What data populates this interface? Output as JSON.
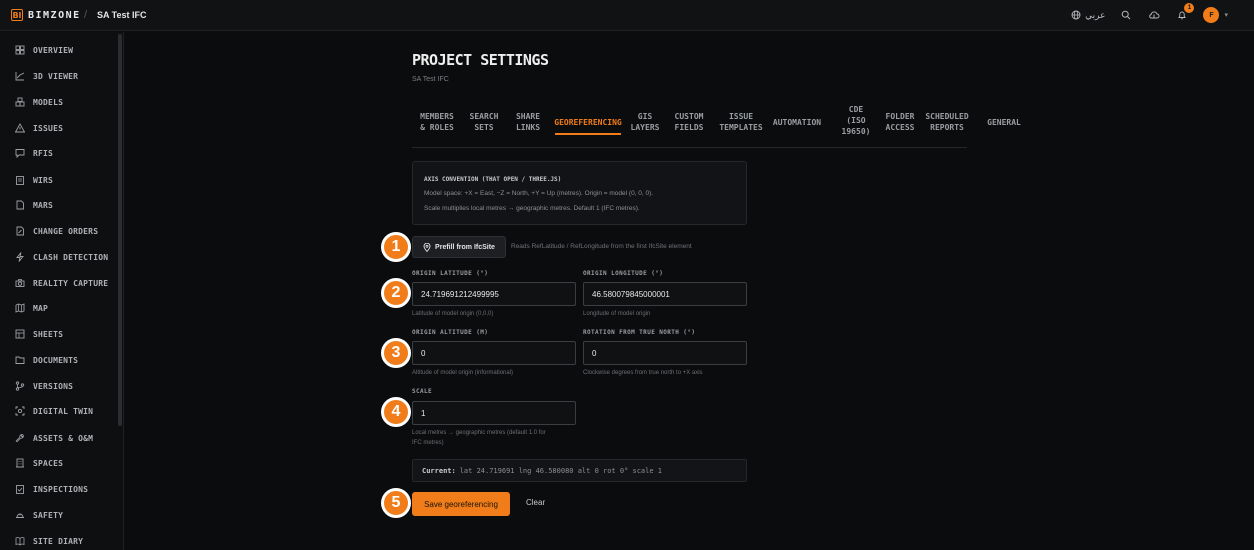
{
  "topbar": {
    "logo_mark": "BI",
    "logo_text": "BIMZONE",
    "crumb_sep": "/",
    "project": "SA Test IFC",
    "language": "عربي",
    "notif_count": "1",
    "avatar_initial": "F"
  },
  "sidebar": {
    "items": [
      {
        "label": "OVERVIEW",
        "icon": "grid-icon"
      },
      {
        "label": "3D VIEWER",
        "icon": "axes-icon"
      },
      {
        "label": "MODELS",
        "icon": "cubes-icon"
      },
      {
        "label": "ISSUES",
        "icon": "warning-icon"
      },
      {
        "label": "RFIS",
        "icon": "message-icon"
      },
      {
        "label": "WIRS",
        "icon": "clipboard-icon"
      },
      {
        "label": "MARS",
        "icon": "document-icon"
      },
      {
        "label": "CHANGE ORDERS",
        "icon": "edit-doc-icon"
      },
      {
        "label": "CLASH DETECTION",
        "icon": "bolt-icon"
      },
      {
        "label": "REALITY CAPTURE",
        "icon": "camera-icon"
      },
      {
        "label": "MAP",
        "icon": "map-icon"
      },
      {
        "label": "SHEETS",
        "icon": "sheets-icon"
      },
      {
        "label": "DOCUMENTS",
        "icon": "folder-icon"
      },
      {
        "label": "VERSIONS",
        "icon": "branch-icon"
      },
      {
        "label": "DIGITAL TWIN",
        "icon": "scan-icon"
      },
      {
        "label": "ASSETS & O&M",
        "icon": "wrench-icon"
      },
      {
        "label": "SPACES",
        "icon": "building-icon"
      },
      {
        "label": "INSPECTIONS",
        "icon": "checklist-icon"
      },
      {
        "label": "SAFETY",
        "icon": "hardhat-icon"
      },
      {
        "label": "SITE DIARY",
        "icon": "book-icon"
      }
    ]
  },
  "page": {
    "title": "PROJECT SETTINGS",
    "subtitle": "SA Test IFC"
  },
  "tabs": [
    {
      "label": "MEMBERS\n& ROLES"
    },
    {
      "label": "SEARCH\nSETS"
    },
    {
      "label": "SHARE\nLINKS"
    },
    {
      "label": "GEOREFERENCING",
      "active": true
    },
    {
      "label": "GIS\nLAYERS"
    },
    {
      "label": "CUSTOM\nFIELDS"
    },
    {
      "label": "ISSUE\nTEMPLATES"
    },
    {
      "label": "AUTOMATION"
    },
    {
      "label": "CDE\n(ISO\n19650)"
    },
    {
      "label": "FOLDER\nACCESS"
    },
    {
      "label": "SCHEDULED\nREPORTS"
    },
    {
      "label": "GENERAL"
    }
  ],
  "info": {
    "title": "AXIS CONVENTION (THAT OPEN / THREE.JS)",
    "line1": "Model space: +X = East, −Z = North, +Y = Up (metres). Origin = model (0, 0, 0).",
    "line2": "Scale multiplies local metres → geographic metres. Default 1 (IFC metres)."
  },
  "prefill": {
    "label": "Prefill from IfcSite",
    "note": "Reads RefLatitude / RefLongitude from the first IfcSite element"
  },
  "fields": {
    "lat": {
      "label": "ORIGIN LATITUDE (°)",
      "value": "24.719691212499995",
      "hint": "Latitude of model origin (0,0,0)"
    },
    "lng": {
      "label": "ORIGIN LONGITUDE (°)",
      "value": "46.580079845000001",
      "hint": "Longitude of model origin"
    },
    "alt": {
      "label": "ORIGIN ALTITUDE (M)",
      "value": "0",
      "hint": "Altitude of model origin (informational)"
    },
    "rot": {
      "label": "ROTATION FROM TRUE NORTH (°)",
      "value": "0",
      "hint": "Clockwise degrees from true north to +X axis"
    },
    "scale": {
      "label": "SCALE",
      "value": "1",
      "hint1": "Local metres → geographic metres (default 1.0 for",
      "hint2": "IFC metres)"
    }
  },
  "current": {
    "label": "Current:",
    "value": "lat 24.719691 lng 46.580080 alt 0 rot 0° scale 1"
  },
  "actions": {
    "save": "Save georeferencing",
    "clear": "Clear"
  },
  "callouts": [
    "1",
    "2",
    "3",
    "4",
    "5"
  ],
  "colors": {
    "accent": "#f07d1a",
    "background": "#0b0c0e",
    "panel": "#121316"
  }
}
